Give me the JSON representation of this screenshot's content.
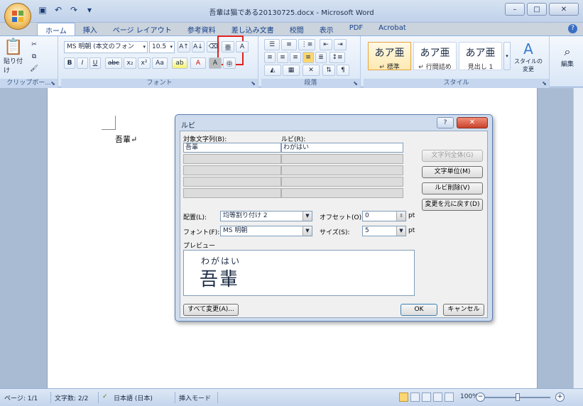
{
  "window": {
    "title": "吾輩は猫である20130725.docx - Microsoft Word",
    "controls": [
      "–",
      "□",
      "✕"
    ]
  },
  "ribbon_tabs": [
    {
      "label": "ホーム",
      "active": true
    },
    {
      "label": "挿入"
    },
    {
      "label": "ページ レイアウト"
    },
    {
      "label": "参考資料"
    },
    {
      "label": "差し込み文書"
    },
    {
      "label": "校閲"
    },
    {
      "label": "表示"
    },
    {
      "label": "PDF"
    },
    {
      "label": "Acrobat"
    }
  ],
  "clipboard": {
    "paste_label": "貼り付け",
    "group_label": "クリップボー..."
  },
  "font_group": {
    "font_name": "MS 明朝 (本文のフォン",
    "font_size": "10.5",
    "buttons": [
      "B",
      "I",
      "U",
      "abc",
      "x₂",
      "x²",
      "Aa"
    ],
    "group_label": "フォント"
  },
  "paragraph_group": {
    "group_label": "段落"
  },
  "styles_group": {
    "tiles": [
      {
        "sample": "あア亜",
        "name": "↵ 標準",
        "selected": true
      },
      {
        "sample": "あア亜",
        "name": "↵ 行間詰め"
      },
      {
        "sample": "あア亜",
        "name": "見出し 1"
      }
    ],
    "change_styles": "スタイルの変更",
    "group_label": "スタイル"
  },
  "editing_group": {
    "label": "編集"
  },
  "document": {
    "text": "吾輩↵"
  },
  "ruby_dialog": {
    "title": "ルビ",
    "base_text_header": "対象文字列(B):",
    "ruby_header": "ルビ(R):",
    "rows": [
      {
        "base": "吾輩",
        "ruby": "わがはい"
      },
      {
        "base": "",
        "ruby": ""
      },
      {
        "base": "",
        "ruby": ""
      },
      {
        "base": "",
        "ruby": ""
      },
      {
        "base": "",
        "ruby": ""
      }
    ],
    "buttons": {
      "whole_string": "文字列全体(G)",
      "per_char": "文字単位(M)",
      "delete_ruby": "ルビ削除(V)",
      "reset": "変更を元に戻す(D)",
      "apply_all": "すべて変更(A)...",
      "ok": "OK",
      "cancel": "キャンセル"
    },
    "alignment_label": "配置(L):",
    "alignment_value": "均等割り付け 2",
    "offset_label": "オフセット(O):",
    "offset_value": "0",
    "offset_unit": "pt",
    "font_label": "フォント(F):",
    "font_value": "MS 明朝",
    "size_label": "サイズ(S):",
    "size_value": "5",
    "size_unit": "pt",
    "preview_label": "プレビュー",
    "preview_ruby": "わがはい",
    "preview_base": "吾輩"
  },
  "statusbar": {
    "page": "ページ: 1/1",
    "words": "文字数: 2/2",
    "language": "日本語 (日本)",
    "mode": "挿入モード",
    "zoom": "100%"
  }
}
